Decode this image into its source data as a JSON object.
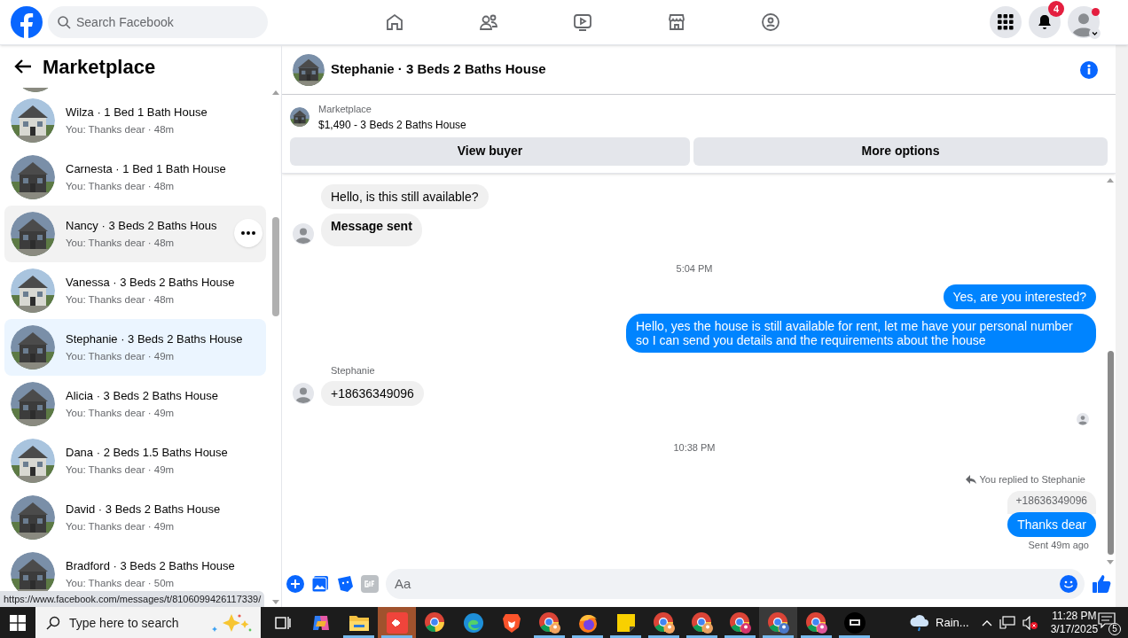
{
  "topbar": {
    "search": {
      "placeholder": "Search Facebook"
    },
    "nav": [
      {
        "kind": "home"
      },
      {
        "kind": "friends"
      },
      {
        "kind": "watch"
      },
      {
        "kind": "marketplace"
      },
      {
        "kind": "groups"
      }
    ],
    "notifications_badge": "4",
    "profile_dot": true
  },
  "sidebar": {
    "title": "Marketplace",
    "conversations": [
      {
        "name": "Wilza · 1 Bed 1 Bath House",
        "preview": "You: Thanks dear · 48m",
        "selected": false,
        "hovered": false
      },
      {
        "name": "Carnesta · 1 Bed 1 Bath House",
        "preview": "You: Thanks dear · 48m",
        "selected": false,
        "hovered": false
      },
      {
        "name": "Nancy · 3 Beds 2 Baths Hous",
        "preview": "You: Thanks dear · 48m",
        "selected": false,
        "hovered": true
      },
      {
        "name": "Vanessa · 3 Beds 2 Baths House",
        "preview": "You: Thanks dear · 48m",
        "selected": false,
        "hovered": false
      },
      {
        "name": "Stephanie · 3 Beds 2 Baths House",
        "preview": "You: Thanks dear · 49m",
        "selected": true,
        "hovered": false
      },
      {
        "name": "Alicia · 3 Beds 2 Baths House",
        "preview": "You: Thanks dear · 49m",
        "selected": false,
        "hovered": false
      },
      {
        "name": "Dana · 2 Beds 1.5 Baths House",
        "preview": "You: Thanks dear · 49m",
        "selected": false,
        "hovered": false
      },
      {
        "name": "David · 3 Beds 2 Baths House",
        "preview": "You: Thanks dear · 49m",
        "selected": false,
        "hovered": false
      },
      {
        "name": "Bradford · 3 Beds 2 Baths House",
        "preview": "You: Thanks dear · 50m",
        "selected": false,
        "hovered": false
      }
    ],
    "status_url": "https://www.facebook.com/messages/t/8106099426117339/"
  },
  "chat": {
    "title": "Stephanie · 3 Beds 2 Baths House",
    "listing": {
      "label": "Marketplace",
      "title": "$1,490 - 3 Beds 2 Baths House"
    },
    "buttons": [
      "View buyer",
      "More options"
    ],
    "messages": [
      {
        "kind": "incoming",
        "text": "Hello, is this still available?",
        "avatar": false
      },
      {
        "kind": "incoming_bold",
        "text": "Message sent",
        "avatar": true
      },
      {
        "kind": "time",
        "text": "5:04 PM"
      },
      {
        "kind": "outgoing",
        "text": "Yes, are you interested?"
      },
      {
        "kind": "outgoing",
        "text": "Hello, yes the house is still available for rent, let me have your personal number so I can send you details and the requirements about the house"
      },
      {
        "kind": "sender",
        "text": "Stephanie"
      },
      {
        "kind": "incoming",
        "text": "+18636349096",
        "avatar": true
      },
      {
        "kind": "seen"
      },
      {
        "kind": "time",
        "text": "10:38 PM"
      },
      {
        "kind": "reply_note",
        "text": "You replied to Stephanie"
      },
      {
        "kind": "quoted",
        "text": "+18636349096"
      },
      {
        "kind": "outgoing",
        "text": "Thanks dear"
      },
      {
        "kind": "status",
        "text": "Sent 49m ago"
      }
    ],
    "composer": {
      "placeholder": "Aa"
    }
  },
  "taskbar": {
    "search": {
      "placeholder": "Type here to search"
    },
    "apps": [
      {
        "kind": "taskview",
        "running": false,
        "selected": false
      },
      {
        "kind": "copilot",
        "running": false,
        "selected": false
      },
      {
        "kind": "explorer",
        "running": true,
        "selected": false
      },
      {
        "kind": "anydesk",
        "running": true,
        "selected": true
      },
      {
        "kind": "chrome",
        "running": false,
        "selected": false
      },
      {
        "kind": "edge",
        "running": false,
        "selected": false
      },
      {
        "kind": "brave",
        "running": false,
        "selected": false
      },
      {
        "kind": "chrome_profile",
        "color": "#f4a460",
        "running": true,
        "selected": false
      },
      {
        "kind": "firefox",
        "running": true,
        "selected": false
      },
      {
        "kind": "sticky",
        "running": true,
        "selected": false
      },
      {
        "kind": "chrome_profile",
        "color": "#f4a460",
        "running": true,
        "selected": false
      },
      {
        "kind": "chrome_profile",
        "color": "#e8a060",
        "running": true,
        "selected": false
      },
      {
        "kind": "chrome_profile",
        "color": "#d6336c",
        "running": true,
        "selected": false
      },
      {
        "kind": "chrome_profile",
        "color": "#4a78c8",
        "running": true,
        "selected": true
      },
      {
        "kind": "chrome_profile",
        "color": "#e0559a",
        "running": true,
        "selected": false
      },
      {
        "kind": "dark",
        "running": true,
        "selected": false
      }
    ],
    "weather": "Rain...",
    "time": "11:28 PM",
    "date": "3/17/2025",
    "notifications": "5"
  }
}
